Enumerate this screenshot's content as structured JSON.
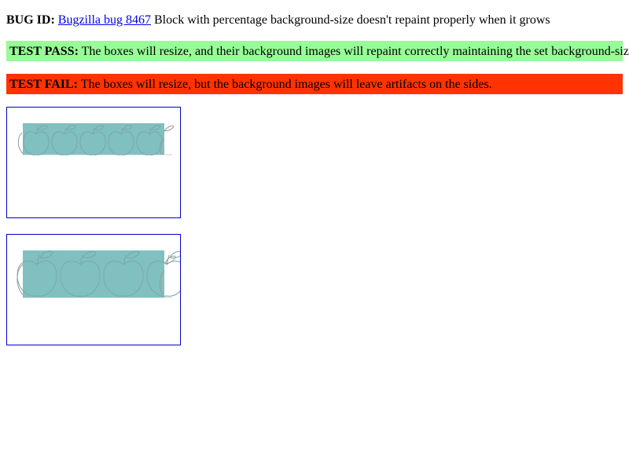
{
  "bug": {
    "label": "BUG ID:",
    "link_text": "Bugzilla bug 8467",
    "description": "Block with percentage background-size doesn't repaint properly when it grows"
  },
  "pass": {
    "label": "TEST PASS:",
    "text": "The boxes will resize, and their background images will repaint correctly maintaining the set background-size."
  },
  "fail": {
    "label": "TEST FAIL:",
    "text": "The boxes will resize, but the background images will leave artifacts on the sides."
  },
  "colors": {
    "link": "#0000ee",
    "pass_bg": "#98fb98",
    "fail_bg": "#ff3300",
    "box_border": "#0000cc",
    "tile_fill": "#80c0c0",
    "apple_stroke": "#7aa8a8"
  },
  "boxes": [
    {
      "name": "small-apple-box",
      "icon": "apple-icon",
      "apple_count": 6
    },
    {
      "name": "large-apple-box",
      "icon": "apple-icon",
      "apple_count": 4
    }
  ]
}
